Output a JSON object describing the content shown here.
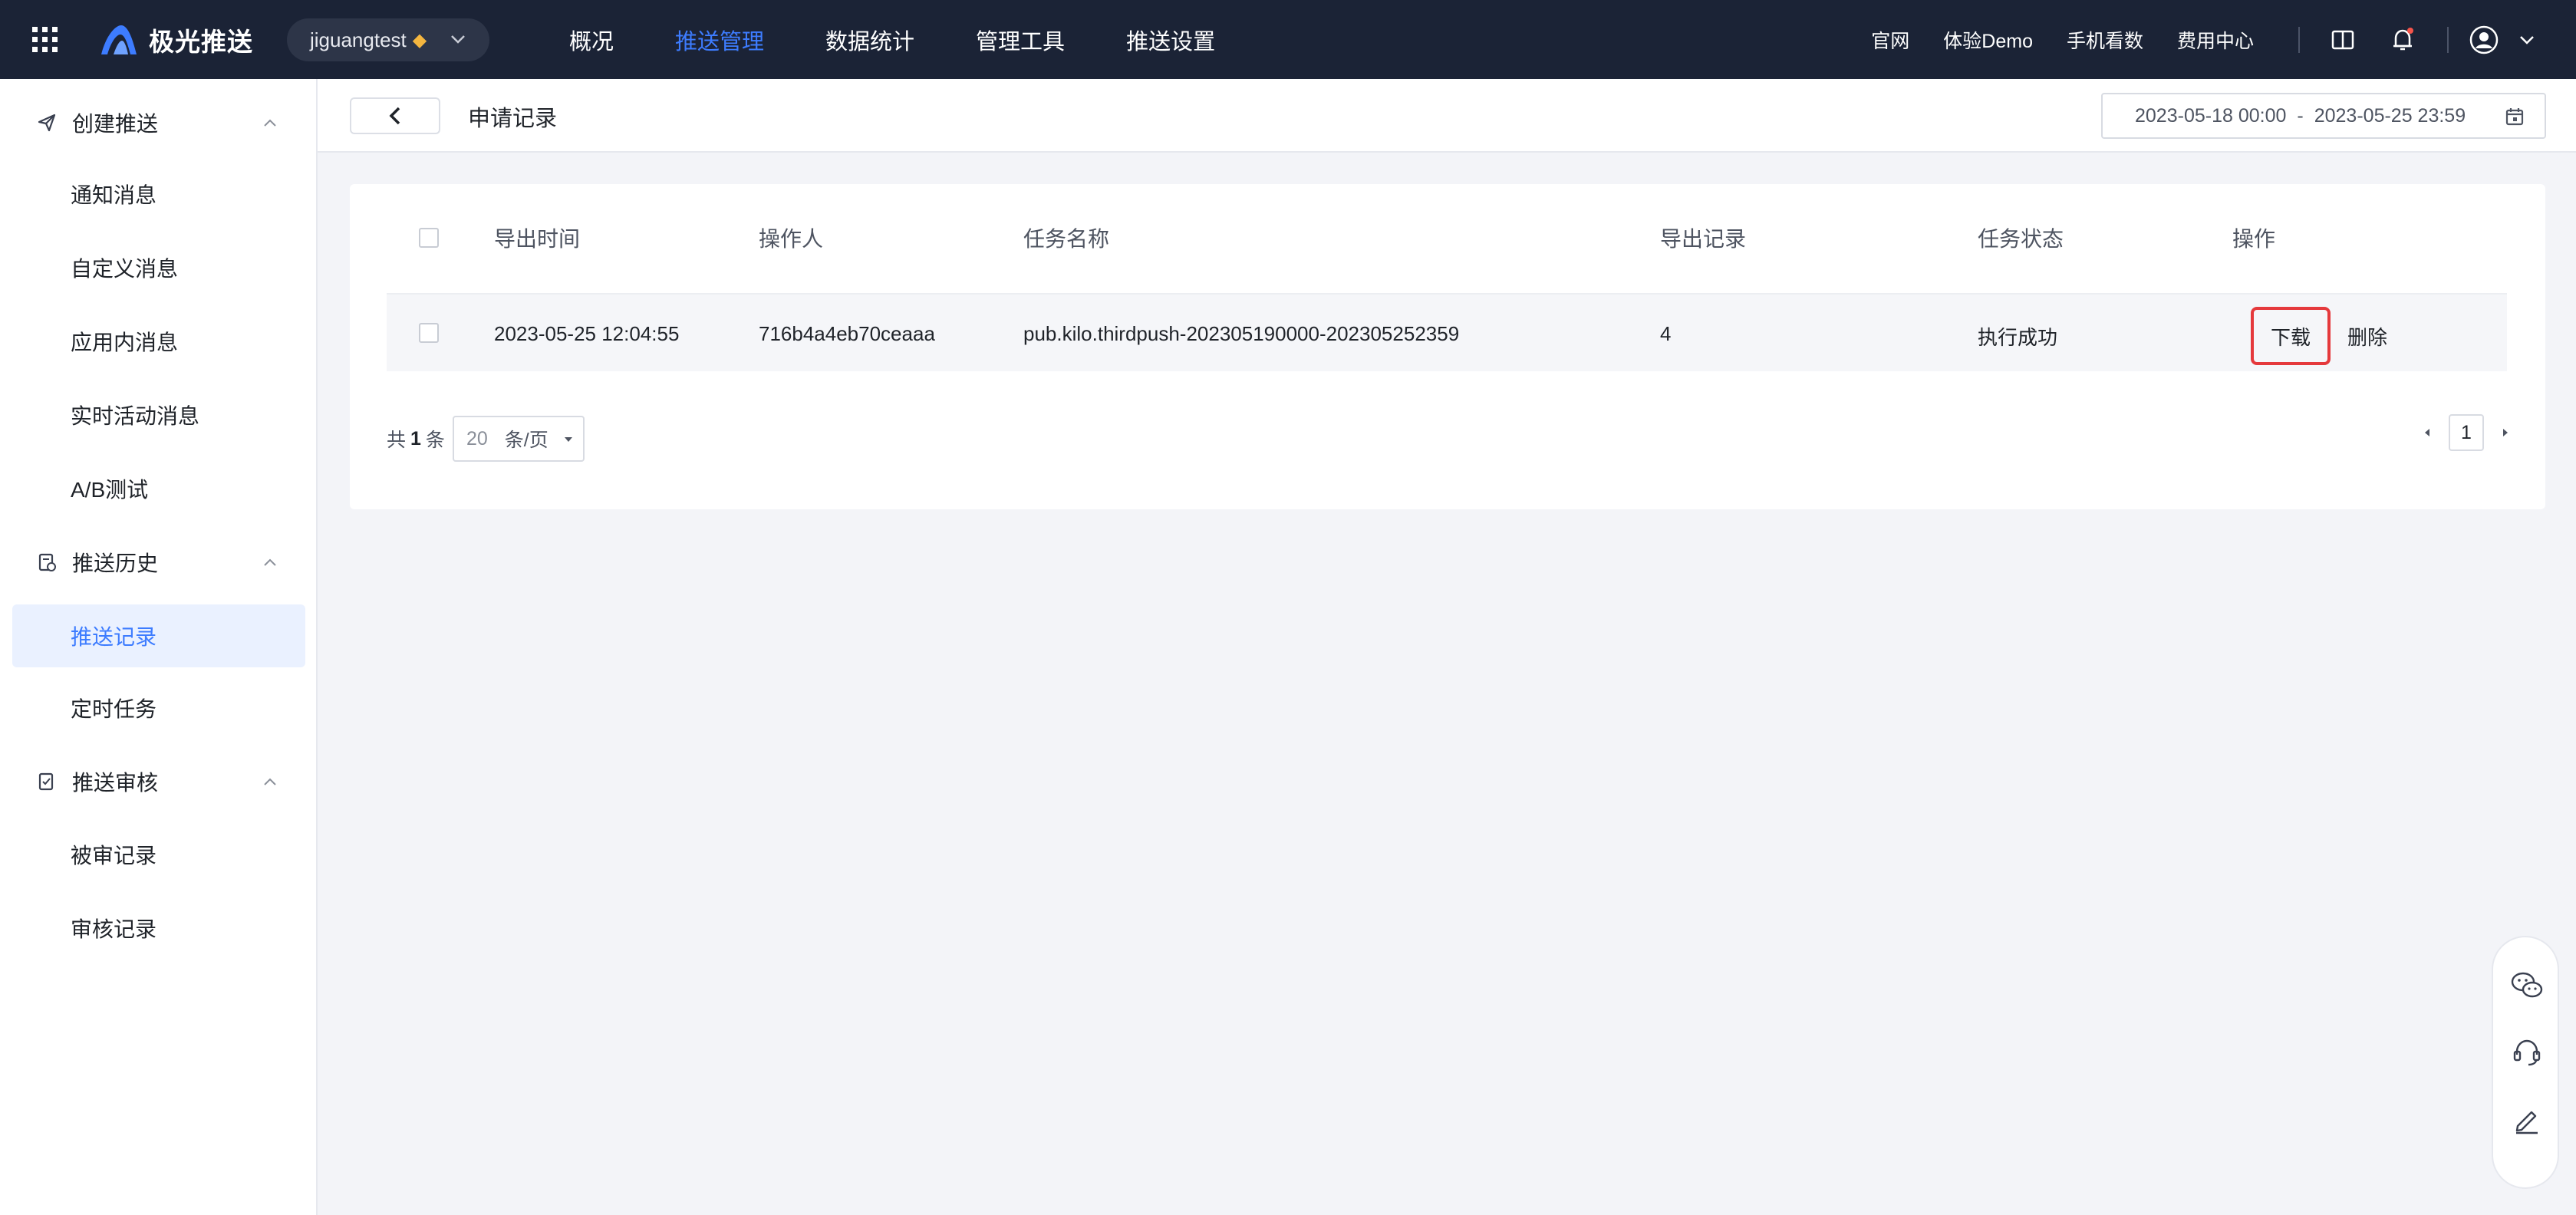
{
  "brand": {
    "name": "极光推送"
  },
  "app_switch": {
    "name": "jiguangtest",
    "badge_icon": "diamond-icon"
  },
  "nav": {
    "items": [
      {
        "label": "概况",
        "active": false
      },
      {
        "label": "推送管理",
        "active": true
      },
      {
        "label": "数据统计",
        "active": false
      },
      {
        "label": "管理工具",
        "active": false
      },
      {
        "label": "推送设置",
        "active": false
      }
    ],
    "right_links": [
      "官网",
      "体验Demo",
      "手机看数",
      "费用中心"
    ],
    "accent": "#3d7cff"
  },
  "sidebar": {
    "groups": [
      {
        "title": "创建推送",
        "icon": "send-icon",
        "items": [
          "通知消息",
          "自定义消息",
          "应用内消息",
          "实时活动消息",
          "A/B测试"
        ]
      },
      {
        "title": "推送历史",
        "icon": "history-icon",
        "items": [
          "推送记录",
          "定时任务"
        ]
      },
      {
        "title": "推送审核",
        "icon": "audit-icon",
        "items": [
          "被审记录",
          "审核记录"
        ]
      }
    ],
    "active_item": "推送记录"
  },
  "subheader": {
    "title": "申请记录",
    "date_start": "2023-05-18 00:00",
    "date_sep": "-",
    "date_end": "2023-05-25 23:59"
  },
  "table": {
    "columns": [
      "导出时间",
      "操作人",
      "任务名称",
      "导出记录",
      "任务状态",
      "操作"
    ],
    "rows": [
      {
        "export_time": "2023-05-25 12:04:55",
        "operator": "716b4a4eb70ceaaa",
        "task_name": "pub.kilo.thirdpush-202305190000-202305252359",
        "export_count": "4",
        "status": "执行成功",
        "actions": [
          "下载",
          "删除"
        ]
      }
    ]
  },
  "pagination": {
    "total_prefix": "共",
    "total": "1",
    "total_suffix": "条",
    "page_size": "20",
    "page_size_unit": "条/页",
    "current_page": "1"
  },
  "highlight_color": "#e5393c"
}
